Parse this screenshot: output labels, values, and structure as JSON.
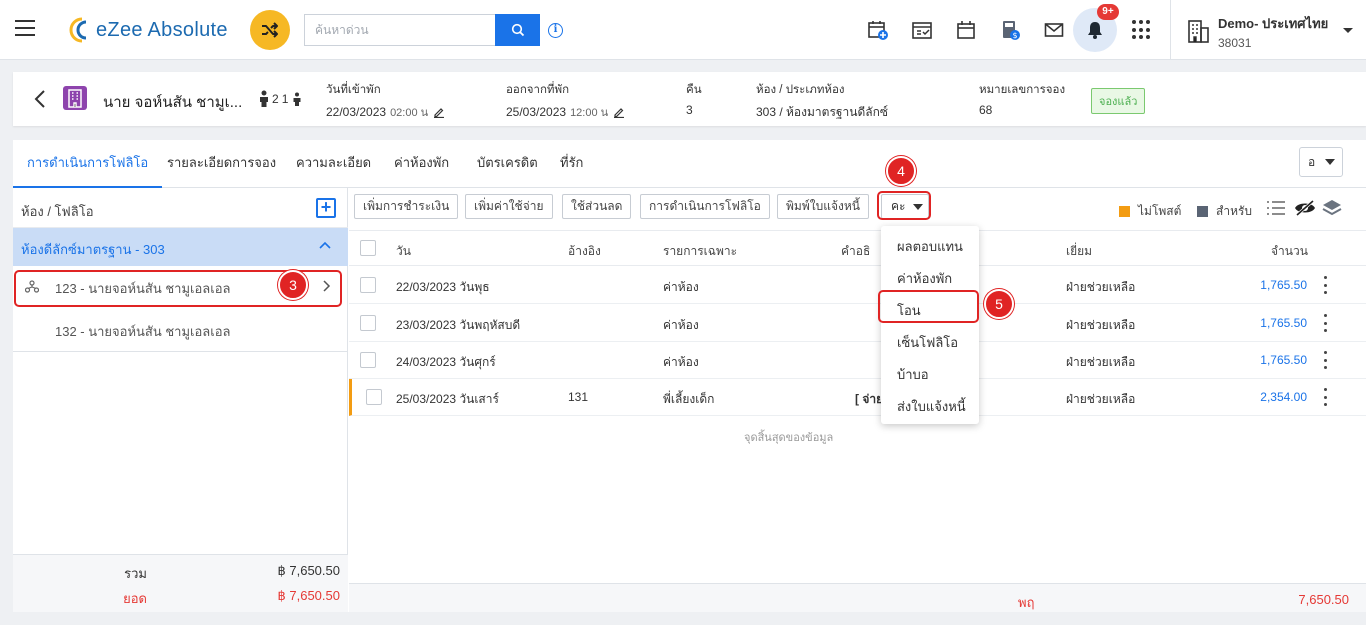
{
  "header": {
    "brand": "eZee Absolute",
    "search_placeholder": "ค้นหาด่วน",
    "notification_badge": "9+",
    "property_name": "Demo- ประเทศไทย",
    "property_code": "38031"
  },
  "booking": {
    "guest_name": "นาย จอห์นสัน ชามูเ...",
    "adults": "2",
    "children": "1",
    "checkin_label": "วันที่เข้าพัก",
    "checkin_date": "22/03/2023",
    "checkin_time": "02:00 น",
    "checkout_label": "ออกจากที่พัก",
    "checkout_date": "25/03/2023",
    "checkout_time": "12:00 น",
    "nights_label": "คืน",
    "nights": "3",
    "room_label": "ห้อง / ประเภทห้อง",
    "room": "303 / ห้องมาตรฐานดีลักซ์",
    "reservation_label": "หมายเลขการจอง",
    "reservation_no": "68",
    "status": "จองแล้ว"
  },
  "tabs": [
    "การดำเนินการโฟลิโอ",
    "รายละเอียดการจอง",
    "ความละเอียด",
    "ค่าห้องพัก",
    "บัตรเครดิต",
    "ที่รัก"
  ],
  "view_select": "อ",
  "folio": {
    "title": "ห้อง / โฟลิโอ",
    "room_group": "ห้องดีลักซ์มาตรฐาน - 303",
    "items": [
      "123 - นายจอห์นสัน ชามูเอลเอล",
      "132 - นายจอห์นสัน ชามูเอลเอล"
    ],
    "total_label": "รวม",
    "total_value": "฿ 7,650.50",
    "balance_label": "ยอด",
    "balance_value": "฿ 7,650.50"
  },
  "toolbar": {
    "add_payment": "เพิ่มการชำระเงิน",
    "add_charge": "เพิ่มค่าใช้จ่าย",
    "discount": "ใช้ส่วนลด",
    "folio_ops": "การดำเนินการโฟลิโอ",
    "print_invoice": "พิมพ์ใบแจ้งหนี้",
    "more": "คะ"
  },
  "legend": {
    "unposted": "ไม่โพสต์",
    "for": "สำหรับ"
  },
  "colors": {
    "unposted": "#f39c12",
    "for": "#5a6474",
    "accent": "#1a73e8",
    "negative": "#e53935"
  },
  "grid": {
    "columns": {
      "date": "วัน",
      "ref": "อ้างอิง",
      "particulars": "รายการเฉพาะ",
      "desc": "คำอธิ",
      "user": "เยี่ยม",
      "amount": "จำนวน"
    },
    "rows": [
      {
        "date": "22/03/2023 วันพุธ",
        "ref": "",
        "particulars": "ค่าห้อง",
        "desc": "",
        "user": "ฝ่ายช่วยเหลือ",
        "amount": "1,765.50"
      },
      {
        "date": "23/03/2023 วันพฤหัสบดี",
        "ref": "",
        "particulars": "ค่าห้อง",
        "desc": "",
        "user": "ฝ่ายช่วยเหลือ",
        "amount": "1,765.50"
      },
      {
        "date": "24/03/2023 วันศุกร์",
        "ref": "",
        "particulars": "ค่าห้อง",
        "desc": "",
        "user": "ฝ่ายช่วยเหลือ",
        "amount": "1,765.50"
      },
      {
        "date": "25/03/2023 วันเสาร์",
        "ref": "131",
        "particulars": "พี่เลี้ยงเด็ก",
        "desc": "[ จ่าย",
        "user": "ฝ่ายช่วยเหลือ",
        "amount": "2,354.00"
      }
    ],
    "end_text": "จุดสิ้นสุดของข้อมูล",
    "footer_label": "พฤ",
    "footer_value": "7,650.50"
  },
  "dropdown": [
    "ผลตอบแทน",
    "ค่าห้องพัก",
    "โอน",
    "เซ็นโฟลิโอ",
    "บ้าบอ",
    "ส่งใบแจ้งหนี้"
  ],
  "callouts": [
    "3",
    "4",
    "5"
  ]
}
